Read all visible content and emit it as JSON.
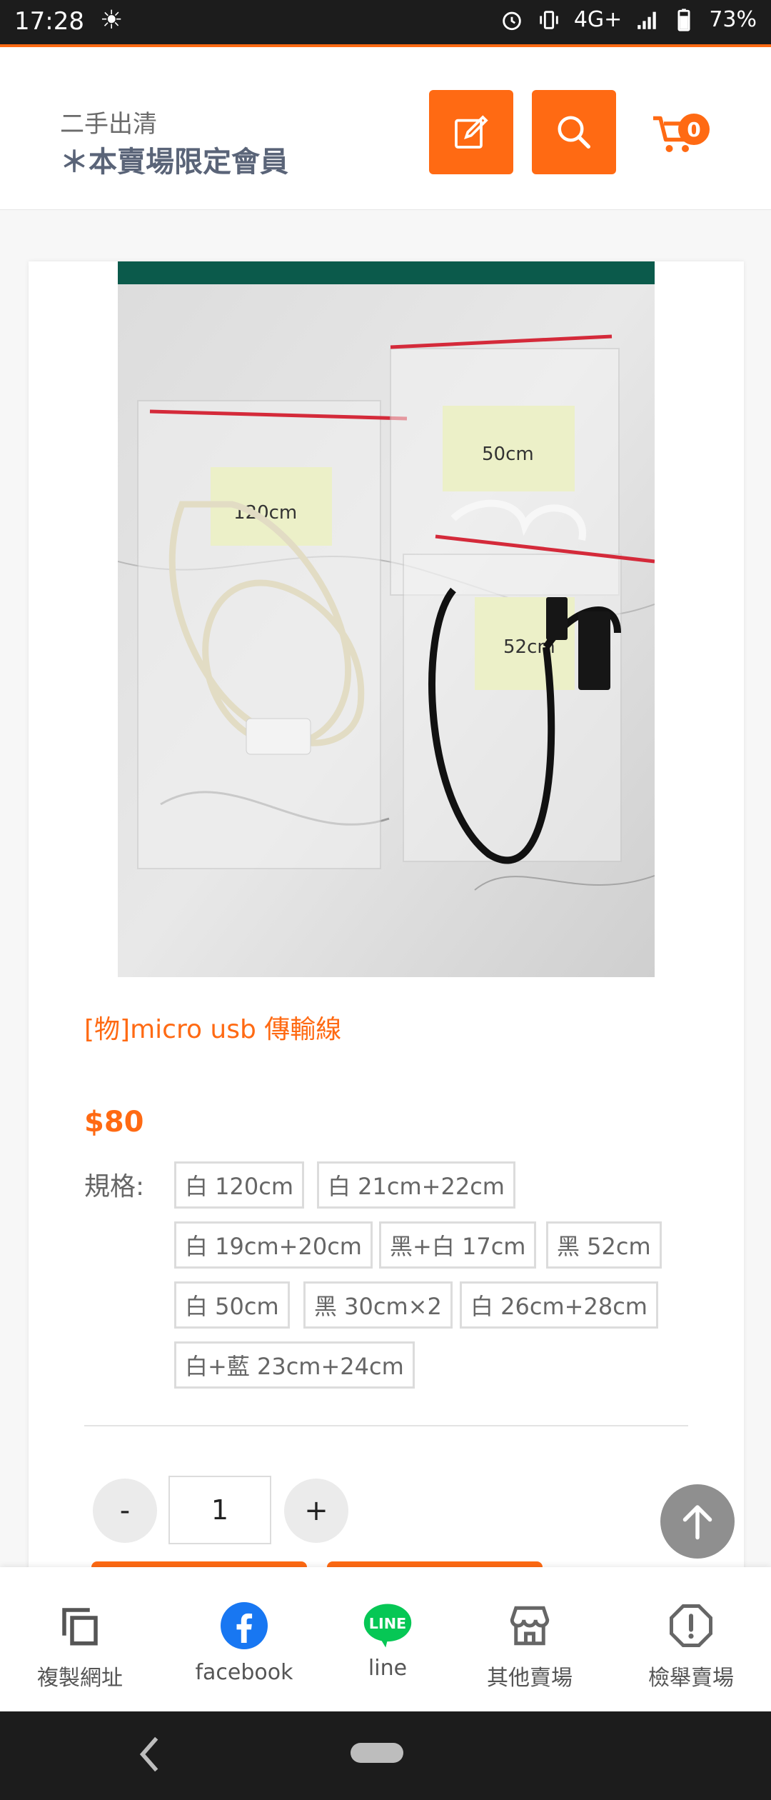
{
  "status_bar": {
    "time": "17:28",
    "network": "4G+",
    "battery": "73%"
  },
  "header": {
    "shop_subtitle": "二手出清",
    "shop_name": "＊本賣場限定會員",
    "cart_count": "0"
  },
  "product": {
    "title": "[物]micro usb 傳輸線",
    "price": "$80",
    "spec_label": "規格:",
    "options": [
      "白 120cm",
      "白 21cm+22cm",
      "白 19cm+20cm",
      "黑+白 17cm",
      "黑 52cm",
      "白 50cm",
      "黑 30cm×2",
      "白 26cm+28cm",
      "白+藍 23cm+24cm"
    ],
    "photo_labels": [
      "120cm",
      "50cm",
      "52cm"
    ]
  },
  "quantity": {
    "minus": "-",
    "value": "1",
    "plus": "+"
  },
  "bottom_nav": [
    {
      "label": "複製網址",
      "icon": "copy-icon"
    },
    {
      "label": "facebook",
      "icon": "facebook-icon"
    },
    {
      "label": "line",
      "icon": "line-icon",
      "badge": "LINE"
    },
    {
      "label": "其他賣場",
      "icon": "store-icon"
    },
    {
      "label": "檢舉賣場",
      "icon": "report-icon"
    }
  ],
  "colors": {
    "accent": "#ff6a13",
    "facebook": "#1877f2",
    "line": "#06c755"
  }
}
